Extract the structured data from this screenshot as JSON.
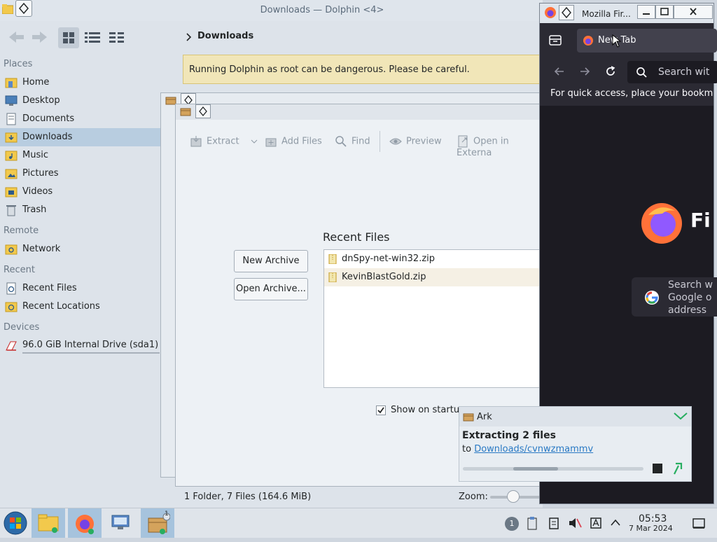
{
  "dolphin": {
    "title": "Downloads — Dolphin <4>",
    "breadcrumb": "Downloads",
    "warning": "Running Dolphin as root can be dangerous. Please be careful.",
    "status": "1 Folder, 7 Files (164.6 MiB)",
    "zoom_label": "Zoom:",
    "places": {
      "places_header": "Places",
      "places_items": [
        "Home",
        "Desktop",
        "Documents",
        "Downloads",
        "Music",
        "Pictures",
        "Videos",
        "Trash"
      ],
      "remote_header": "Remote",
      "remote_items": [
        "Network"
      ],
      "recent_header": "Recent",
      "recent_items": [
        "Recent Files",
        "Recent Locations"
      ],
      "devices_header": "Devices",
      "devices_items": [
        "96.0 GiB Internal Drive (sda1)"
      ]
    }
  },
  "ark": {
    "toolbar": {
      "extract": "Extract",
      "add_files": "Add Files",
      "find": "Find",
      "preview": "Preview",
      "open_external": "Open in Externa"
    },
    "new_archive": "New Archive",
    "open_archive": "Open Archive...",
    "recent_title": "Recent Files",
    "recent_files": [
      "dnSpy-net-win32.zip",
      "KevinBlastGold.zip"
    ],
    "show_on_startup": "Show on startup"
  },
  "firefox": {
    "title": "Mozilla Fir...",
    "tab_label": "New Tab",
    "url_placeholder": "Search wit",
    "bookmarks_hint": "For quick access, place your bookm",
    "logo_text": "Fi",
    "search_placeholder": "Search w\nGoogle o\naddress"
  },
  "notification": {
    "app": "Ark",
    "title": "Extracting 2 files",
    "body_prefix": "to ",
    "link": "Downloads/cvnwzmammv",
    "progress": 0.3
  },
  "taskbar": {
    "badge": "1",
    "time": "05:53",
    "date": "7 Mar 2024"
  },
  "colors": {
    "accent": "#3daee9",
    "selection": "#b8cde0",
    "firefox_bg": "#1c1b22",
    "link": "#2979c4"
  }
}
